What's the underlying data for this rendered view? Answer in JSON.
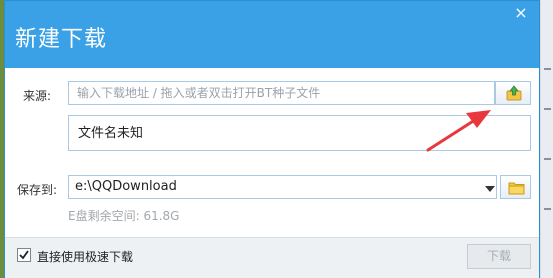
{
  "dialog": {
    "title": "新建下载",
    "close_icon": "×"
  },
  "source": {
    "label": "来源:",
    "placeholder": "输入下载地址 / 拖入或者双击打开BT种子文件",
    "browse_icon": "upload-folder-icon"
  },
  "filename": {
    "value": "文件名未知"
  },
  "save": {
    "label": "保存到:",
    "path": "e:\\QQDownload",
    "free_space": "E盘剩余空间: 61.8G",
    "folder_icon": "folder-icon"
  },
  "footer": {
    "checkbox_label": "直接使用极速下载",
    "checkbox_checked": true,
    "download_button": "下载"
  },
  "colors": {
    "titlebar": "#3aa1e7",
    "annotation_arrow": "#e8383d"
  }
}
